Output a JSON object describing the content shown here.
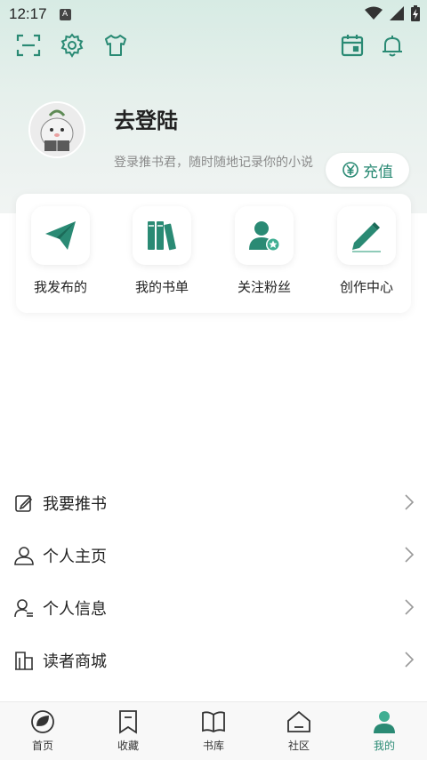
{
  "status_bar": {
    "time": "12:17",
    "badge": "A"
  },
  "profile": {
    "title": "去登陆",
    "subtitle": "登录推书君，随时随地记录你的小说",
    "recharge_label": "充值"
  },
  "quick_actions": [
    {
      "label": "我发布的",
      "icon": "paper-plane-icon"
    },
    {
      "label": "我的书单",
      "icon": "books-icon"
    },
    {
      "label": "关注粉丝",
      "icon": "user-star-icon"
    },
    {
      "label": "创作中心",
      "icon": "pencil-icon"
    }
  ],
  "menu": [
    {
      "label": "我要推书",
      "icon": "edit-icon"
    },
    {
      "label": "个人主页",
      "icon": "user-icon"
    },
    {
      "label": "个人信息",
      "icon": "user-info-icon"
    },
    {
      "label": "读者商城",
      "icon": "building-icon"
    }
  ],
  "bottom_nav": [
    {
      "label": "首页",
      "icon": "home-leaf-icon",
      "active": false
    },
    {
      "label": "收藏",
      "icon": "bookmark-icon",
      "active": false
    },
    {
      "label": "书库",
      "icon": "open-book-icon",
      "active": false
    },
    {
      "label": "社区",
      "icon": "house-icon",
      "active": false
    },
    {
      "label": "我的",
      "icon": "person-icon",
      "active": true
    }
  ],
  "colors": {
    "accent": "#2a8a74",
    "accent_light": "#3fae92",
    "header_bg": "#d7ebe4"
  }
}
